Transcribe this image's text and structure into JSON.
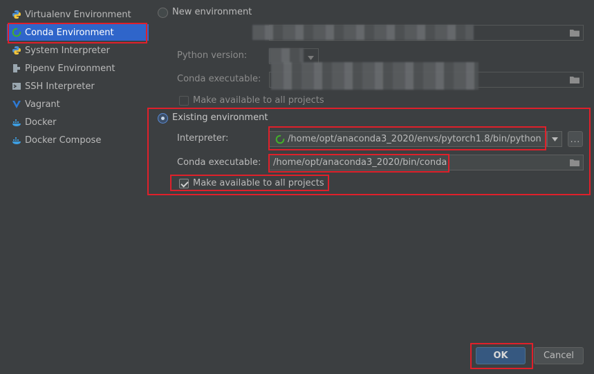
{
  "sidebar": {
    "items": [
      {
        "label": "Virtualenv Environment",
        "icon": "python-icon"
      },
      {
        "label": "Conda Environment",
        "icon": "conda-icon",
        "selected": true
      },
      {
        "label": "System Interpreter",
        "icon": "python-icon"
      },
      {
        "label": "Pipenv Environment",
        "icon": "pipenv-icon"
      },
      {
        "label": "SSH Interpreter",
        "icon": "ssh-icon"
      },
      {
        "label": "Vagrant",
        "icon": "vagrant-icon"
      },
      {
        "label": "Docker",
        "icon": "docker-icon"
      },
      {
        "label": "Docker Compose",
        "icon": "docker-icon"
      }
    ]
  },
  "new_env": {
    "radio_label": "New environment",
    "python_version_label": "Python version:",
    "conda_exec_label": "Conda executable:",
    "make_available_label": "Make available to all projects"
  },
  "existing_env": {
    "radio_label": "Existing environment",
    "interpreter_label": "Interpreter:",
    "interpreter_value": "/home/opt/anaconda3_2020/envs/pytorch1.8/bin/python",
    "conda_exec_label": "Conda executable:",
    "conda_exec_value": "/home/opt/anaconda3_2020/bin/conda",
    "make_available_label": "Make available to all projects",
    "more_button": "..."
  },
  "footer": {
    "ok_label": "OK",
    "cancel_label": "Cancel"
  },
  "colors": {
    "background": "#3c3f41",
    "selection": "#2f65ca",
    "highlight_box": "#e0202a",
    "ok_button": "#365880"
  }
}
